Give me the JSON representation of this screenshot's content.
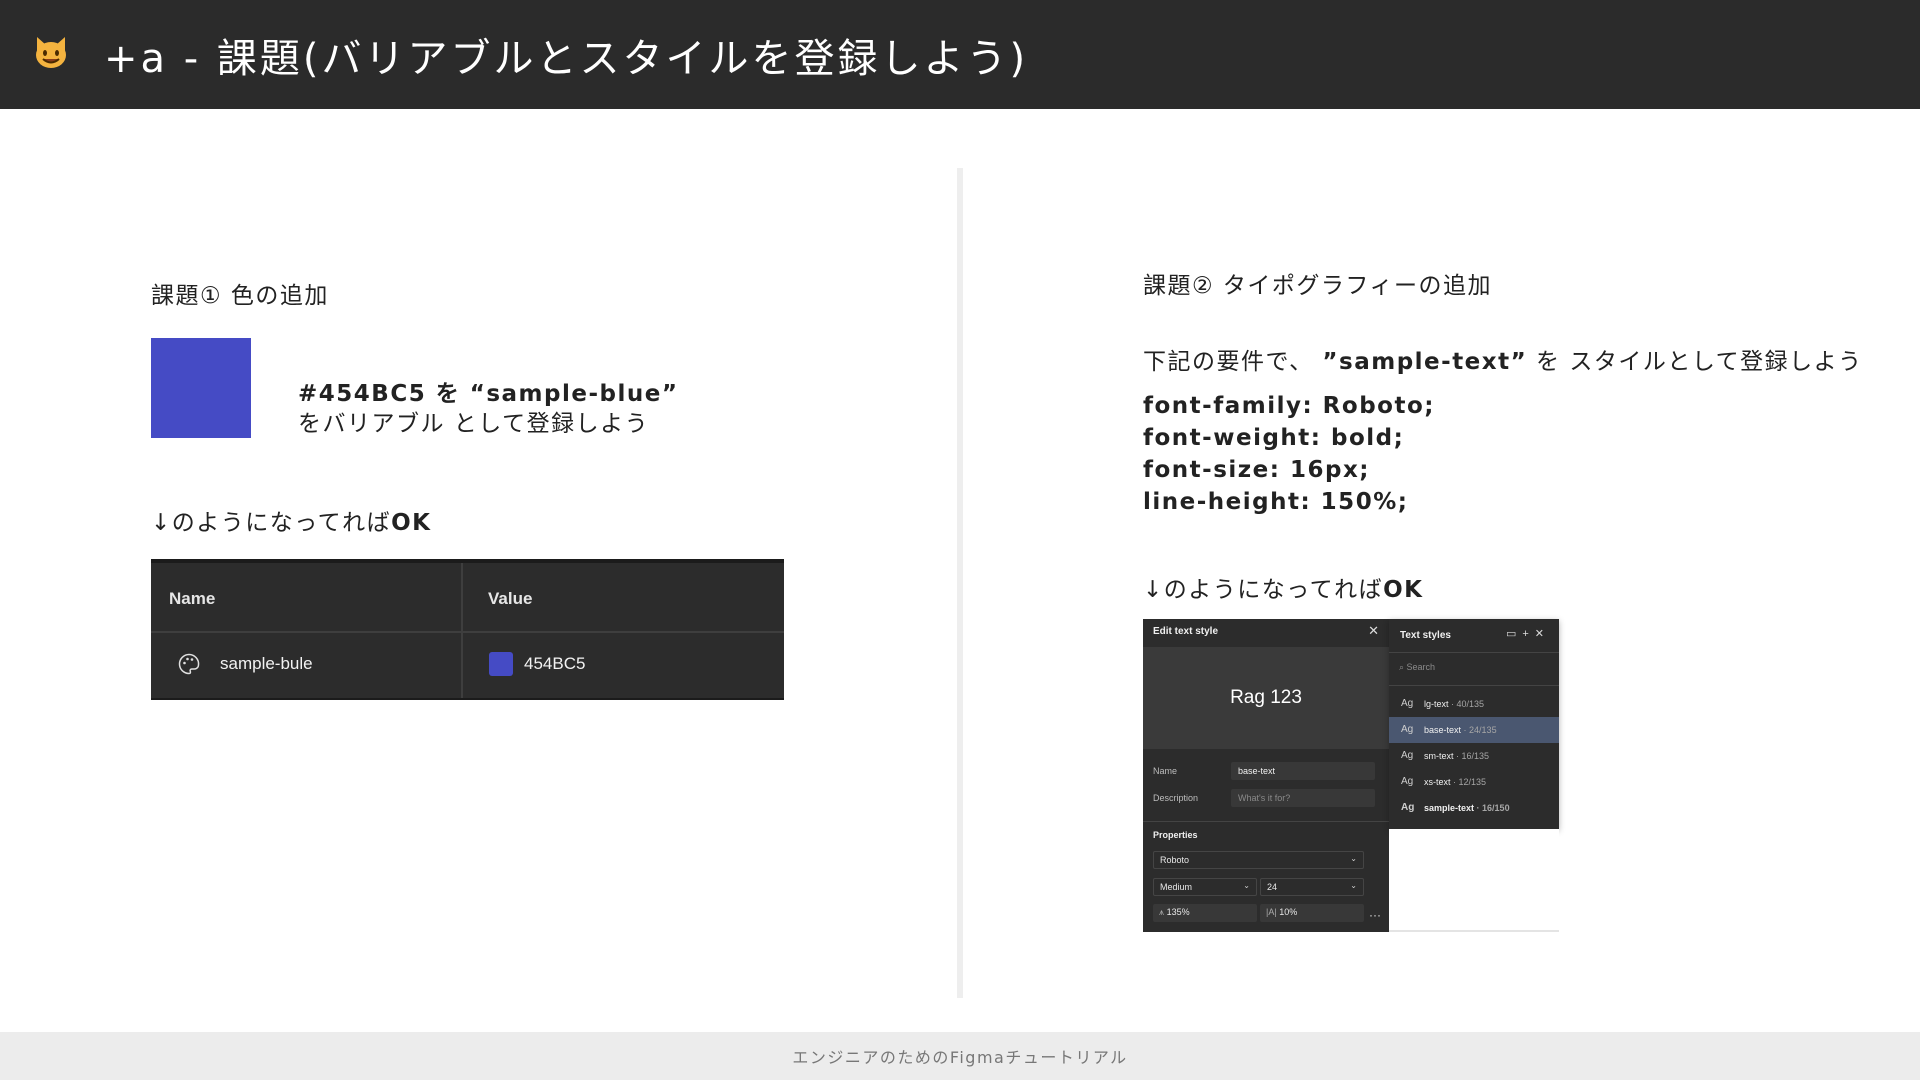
{
  "header": {
    "title": "+a - 課題(バリアブルとスタイルを登録しよう)",
    "emoji": "cat-face-icon"
  },
  "left": {
    "heading": "課題① 色の追加",
    "swatch_color": "#454BC5",
    "instruction_line1": "#454BC5 を “sample-blue”",
    "instruction_line2": "をバリアブル として登録しよう",
    "ok_prefix": "↓のようになってれば",
    "ok_suffix": "OK",
    "table": {
      "header_name": "Name",
      "header_value": "Value",
      "row_name": "sample-bule",
      "row_value": "454BC5"
    }
  },
  "right": {
    "heading": "課題② タイポグラフィーの追加",
    "req_prefix": "下記の要件で、",
    "req_highlight": "”sample-text”",
    "req_suffix": "を スタイルとして登録しよう",
    "code": [
      "font-family: Roboto;",
      "font-weight: bold;",
      "font-size: 16px;",
      "line-height: 150%;"
    ],
    "ok_prefix": "↓のようになってれば",
    "ok_suffix": "OK",
    "edit_panel": {
      "title": "Edit text style",
      "preview": "Rag 123",
      "name_label": "Name",
      "name_value": "base-text",
      "desc_label": "Description",
      "desc_placeholder": "What's it for?",
      "properties_label": "Properties",
      "font": "Roboto",
      "weight": "Medium",
      "size": "24",
      "line_height": "135%",
      "letter_spacing": "10%"
    },
    "styles_panel": {
      "title": "Text styles",
      "search_placeholder": "Search",
      "items": [
        {
          "ag": "Ag",
          "name": "lg-text",
          "size": "· 40/135"
        },
        {
          "ag": "Ag",
          "name": "base-text",
          "size": "· 24/135"
        },
        {
          "ag": "Ag",
          "name": "sm-text",
          "size": "· 16/135"
        },
        {
          "ag": "Ag",
          "name": "xs-text",
          "size": "· 12/135"
        },
        {
          "ag": "Ag",
          "name": "sample-text",
          "size": "· 16/150"
        }
      ]
    }
  },
  "footer": {
    "text": "エンジニアのためのFigmaチュートリアル"
  }
}
